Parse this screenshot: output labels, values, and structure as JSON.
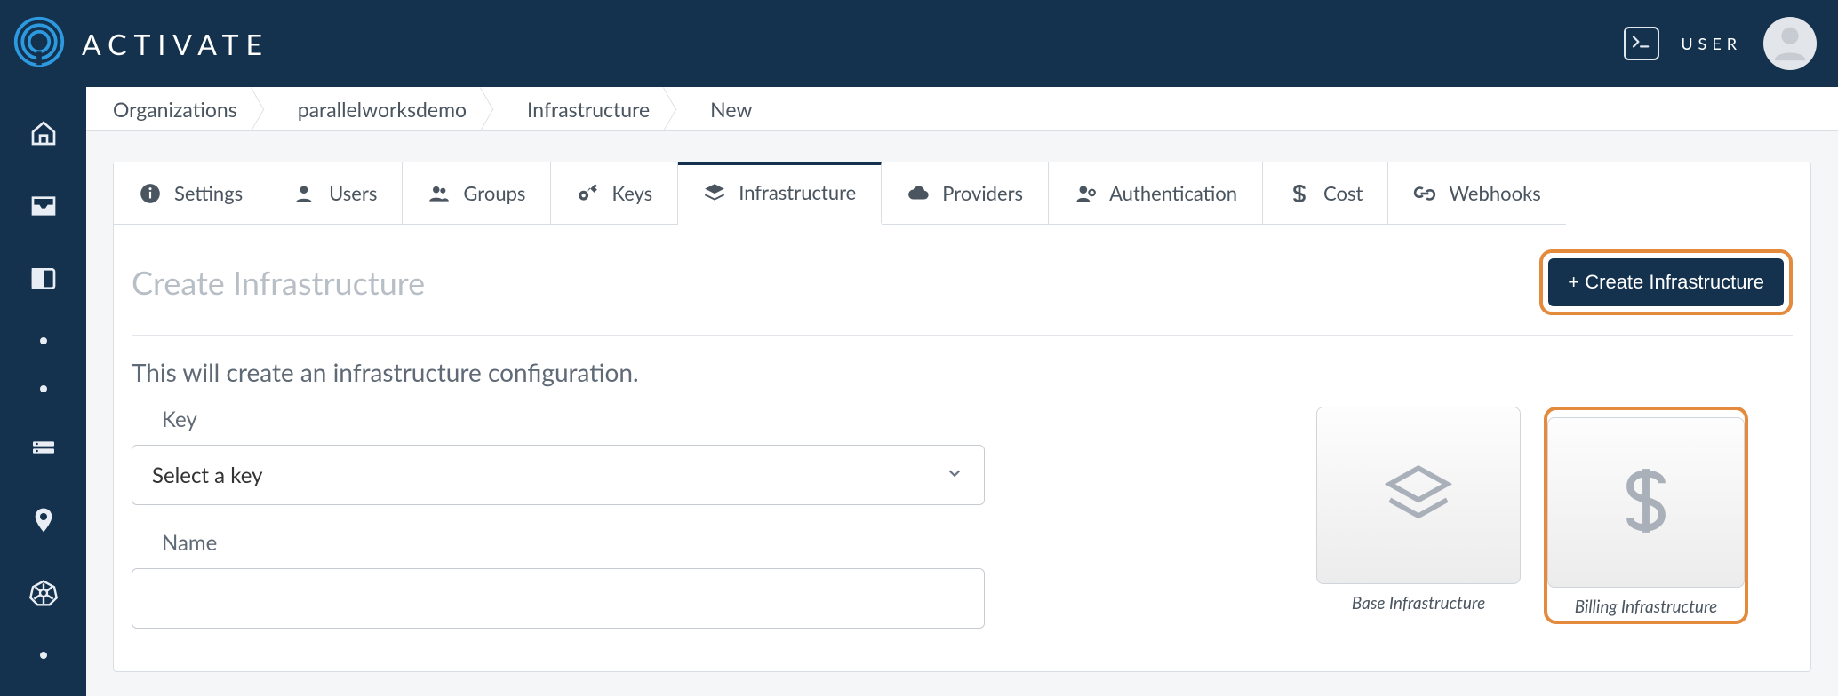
{
  "brand": {
    "name": "ACTIVATE"
  },
  "header": {
    "user_label": "USER"
  },
  "breadcrumb": [
    "Organizations",
    "parallelworksdemo",
    "Infrastructure",
    "New"
  ],
  "tabs": [
    {
      "label": "Settings"
    },
    {
      "label": "Users"
    },
    {
      "label": "Groups"
    },
    {
      "label": "Keys"
    },
    {
      "label": "Infrastructure",
      "active": true
    },
    {
      "label": "Providers"
    },
    {
      "label": "Authentication"
    },
    {
      "label": "Cost"
    },
    {
      "label": "Webhooks"
    }
  ],
  "page": {
    "title": "Create Infrastructure",
    "create_button": "+ Create Infrastructure",
    "subtitle": "This will create an infrastructure configuration.",
    "key_label": "Key",
    "key_select_placeholder": "Select a key",
    "name_label": "Name"
  },
  "infra_cards": [
    {
      "caption": "Base Infrastructure"
    },
    {
      "caption": "Billing Infrastructure",
      "selected": true
    }
  ]
}
